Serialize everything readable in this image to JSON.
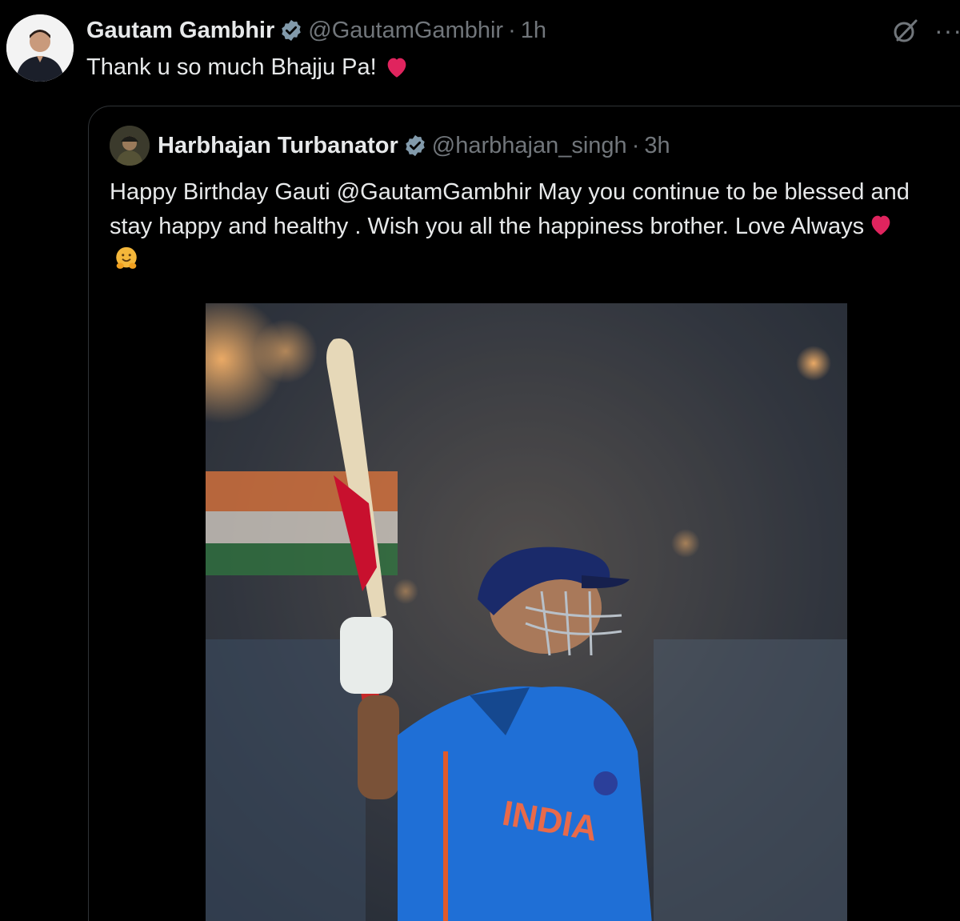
{
  "tweet": {
    "author_name": "Gautam Gambhir",
    "handle": "@GautamGambhir",
    "separator": "·",
    "time": "1h",
    "text": "Thank u so much Bhajju Pa!",
    "emoji_icon": "red-heart-icon"
  },
  "quoted_tweet": {
    "author_name": "Harbhajan Turbanator",
    "handle": "@harbhajan_singh",
    "separator": "·",
    "time": "3h",
    "text": "Happy Birthday Gauti @GautamGambhir May you continue to be blessed and stay happy and healthy . Wish you all the happiness brother. Love Always",
    "emoji_icons": [
      "red-heart-icon",
      "hugging-face-icon"
    ],
    "image_icon": "cricket-player-photo"
  },
  "colors": {
    "background": "#000000",
    "primary_text": "#e7e9ea",
    "secondary_text": "#71767b",
    "verified_badge": "#829aab",
    "border": "#2f3336",
    "heart": "#f91880"
  },
  "icons": {
    "verified": "verified-badge-icon",
    "grok": "grok-icon",
    "more": "more-options-icon"
  }
}
